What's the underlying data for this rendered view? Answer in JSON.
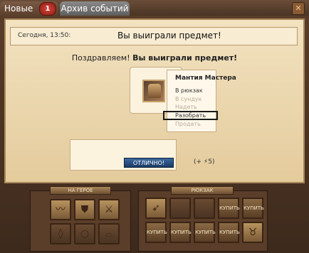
{
  "tabs": {
    "new_label": "Новые",
    "new_badge": "1",
    "archive_label": "Архив событий"
  },
  "header": {
    "date": "Сегодня, 13:50:",
    "title": "Вы выиграли предмет!"
  },
  "congrats": {
    "prefix": "Поздравляем! ",
    "bold": "Вы выиграли предмет!"
  },
  "item_menu": {
    "title": "Мантия Мастера",
    "items": [
      {
        "label": "В рюкзак"
      },
      {
        "label": "В сундук"
      },
      {
        "label": "Надеть"
      },
      {
        "label": "Разобрать"
      },
      {
        "label": "Продать"
      }
    ]
  },
  "ok_button": "ОТЛИЧНО!",
  "reward": "(+ ⚡5)",
  "equip_panel": {
    "title": "НА ГЕРОЕ"
  },
  "backpack_panel": {
    "title": "РЮКЗАК",
    "buy_label": "КУПИТЬ"
  }
}
